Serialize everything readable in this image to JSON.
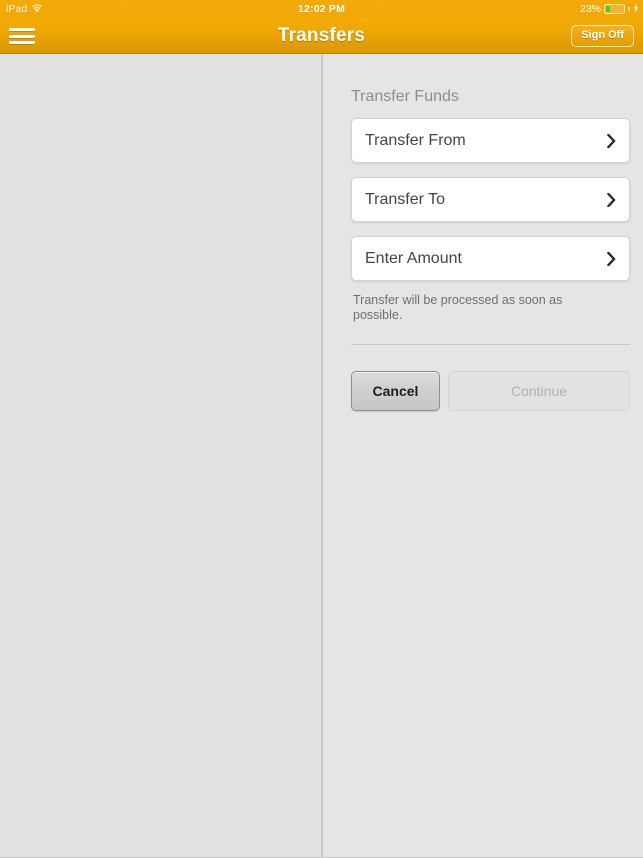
{
  "status_bar": {
    "device_label": "iPad",
    "wifi_icon": "wifi-icon",
    "time": "12:02 PM",
    "battery_percent_label": "23%",
    "battery_level": 23,
    "battery_icon": "battery-icon",
    "charging_icon": "lightning-bolt-icon"
  },
  "nav_bar": {
    "menu_icon": "hamburger-menu-icon",
    "title": "Transfers",
    "sign_off_label": "Sign Off",
    "accent_color": "#eda406",
    "accent_color_dark": "#9c6d05"
  },
  "main": {
    "section_heading": "Transfer Funds",
    "rows": [
      {
        "label": "Transfer From",
        "icon": "chevron-right-icon"
      },
      {
        "label": "Transfer To",
        "icon": "chevron-right-icon"
      },
      {
        "label": "Enter Amount",
        "icon": "chevron-right-icon"
      }
    ],
    "helper_text": "Transfer will be processed as soon as possible.",
    "buttons": {
      "cancel_label": "Cancel",
      "continue_label": "Continue",
      "continue_disabled": true
    }
  },
  "colors": {
    "page_background": "#e3e3e3",
    "card_background": "#ffffff",
    "heading_text": "#8d8d8d",
    "body_text": "#444444",
    "helper_text": "#6f6f6f",
    "disabled_text": "#b2b2b2",
    "battery_fill": "#3fd12a"
  }
}
